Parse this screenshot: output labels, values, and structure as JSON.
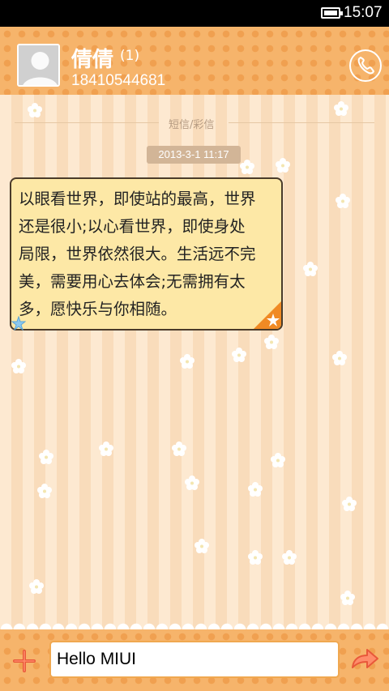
{
  "status_bar": {
    "time": "15:07",
    "battery_level": 1.0
  },
  "header": {
    "contact_name": "倩倩",
    "unread_count": "(1)",
    "phone_number": "18410544681",
    "call_icon": "phone-icon"
  },
  "conversation": {
    "divider_label": "短信/彩信",
    "timestamp": "2013-3-1 11:17",
    "messages": [
      {
        "lines": [
          "以眼看世界，即使站的最高，世界",
          "还是很小;以心看世界，即使身处",
          "局限，世界依然很大。生活远不完",
          "美，需要用心去体会;无需拥有太",
          "多，愿快乐与你相随。"
        ]
      }
    ]
  },
  "composer": {
    "input_value": "Hello MIUI",
    "add_icon": "plus-icon",
    "send_icon": "send-arrow-icon"
  },
  "colors": {
    "accent": "#f6b46b",
    "bubble": "#fde8a6",
    "bubble_border": "#4a3b2a"
  }
}
